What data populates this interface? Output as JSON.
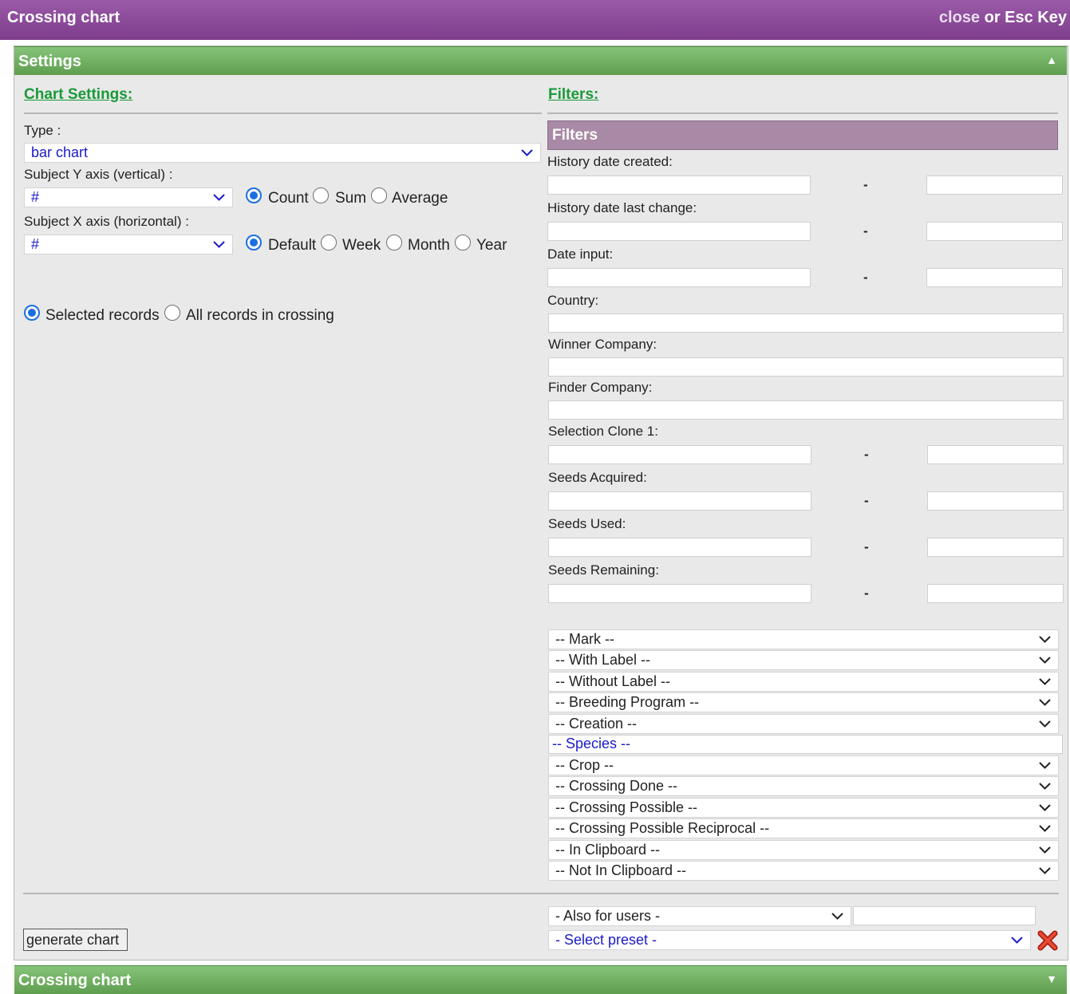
{
  "titlebar": {
    "title": "Crossing chart",
    "close_link": "close",
    "close_rest": " or Esc Key"
  },
  "settings_bar": {
    "label": "Settings",
    "arrow": "▲"
  },
  "chart_settings": {
    "heading": "Chart Settings:",
    "type_label": "Type :",
    "type_value": "bar chart",
    "y_axis_label": "Subject Y axis (vertical) :",
    "y_axis_value": "#",
    "y_options": [
      "Count",
      "Sum",
      "Average"
    ],
    "x_axis_label": "Subject X axis (horizontal) :",
    "x_axis_value": "#",
    "x_options": [
      "Default",
      "Week",
      "Month",
      "Year"
    ],
    "record_options": [
      "Selected records",
      "All records in crossing"
    ]
  },
  "filters": {
    "heading": "Filters:",
    "box_title": "Filters",
    "fields": {
      "history_created": "History date created:",
      "history_changed": "History date last change:",
      "date_input": "Date input:",
      "country": "Country:",
      "winner_company": "Winner Company:",
      "finder_company": "Finder Company:",
      "selection_clone": "Selection Clone 1:",
      "seeds_acquired": "Seeds Acquired:",
      "seeds_used": "Seeds Used:",
      "seeds_remaining": "Seeds Remaining:"
    },
    "range_separator": "-",
    "dropdowns": [
      "-- Mark --",
      "-- With Label --",
      "-- Without Label --",
      "-- Breeding Program --",
      "-- Creation --",
      "-- Species --",
      "-- Crop --",
      "-- Crossing Done --",
      "-- Crossing Possible --",
      "-- Crossing Possible Reciprocal --",
      "-- In Clipboard --",
      "-- Not In Clipboard --"
    ]
  },
  "footer": {
    "generate_button": "generate chart",
    "also_for_users": "- Also for users -",
    "select_preset": "- Select preset -"
  },
  "bottom_bar": {
    "label": "Crossing chart",
    "arrow": "▼"
  },
  "colors": {
    "title_purple": "#8a4a99",
    "section_green": "#6aaa5a",
    "heading_green": "#1a9a3a",
    "filters_purple": "#a98aa6",
    "link_blue": "#1a1ac8",
    "radio_blue": "#1b6fe0",
    "delete_red": "#e03020"
  },
  "icons": [
    "chevron-down-icon",
    "triangle-up-icon",
    "triangle-down-icon",
    "red-x-delete-icon"
  ]
}
